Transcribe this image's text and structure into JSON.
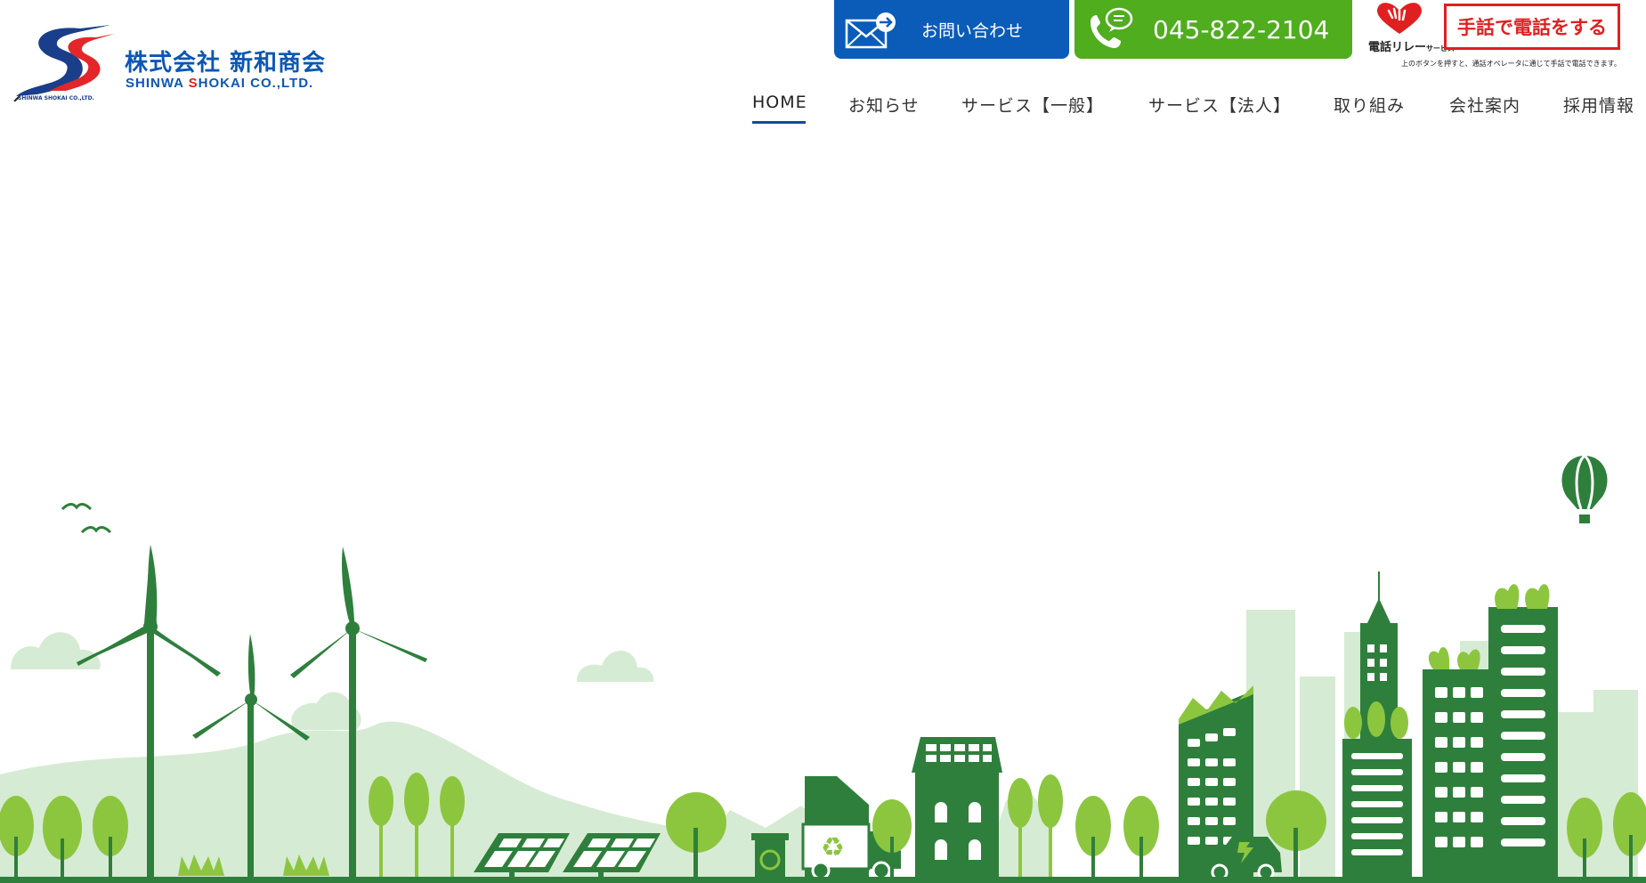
{
  "logo": {
    "company_jp": "株式会社 新和商会",
    "company_en_part1": "SHINWA ",
    "company_en_s": "S",
    "company_en_part2": "HOKAI CO.,LTD.",
    "mark_caption": "SHINWA SHOKAI CO.,LTD."
  },
  "header": {
    "contact_label": "お問い合わせ",
    "phone_label": "045-822-2104",
    "relay_logo_text": "電話リレー",
    "relay_logo_sub": "サービス",
    "relay_button_label": "手話で電話をする",
    "relay_note": "上のボタンを押すと、通話オペレータに通じて手話で電話できます。"
  },
  "nav": {
    "items": [
      {
        "label": "HOME"
      },
      {
        "label": "お知らせ"
      },
      {
        "label": "サービス【一般】"
      },
      {
        "label": "サービス【法人】"
      },
      {
        "label": "取り組み"
      },
      {
        "label": "会社案内"
      },
      {
        "label": "採用情報"
      }
    ]
  },
  "colors": {
    "brand_blue": "#0a5cb8",
    "phone_green": "#4fad1e",
    "relay_red": "#e02020",
    "scene_dark_green": "#2f7f3c",
    "scene_light_green": "#d6ebd3",
    "scene_lime": "#8cc63f"
  }
}
